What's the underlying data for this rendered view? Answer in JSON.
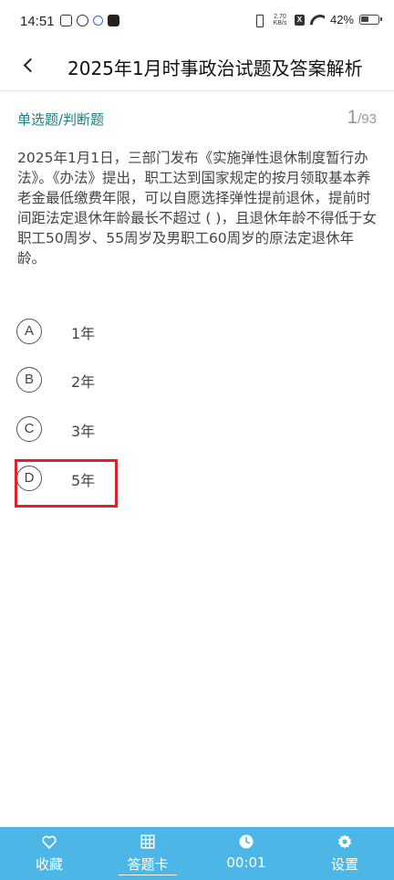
{
  "status_bar": {
    "time": "14:51",
    "net_speed_value": "2.70",
    "net_speed_unit": "KB/s",
    "sim_label": "X",
    "battery": "42%"
  },
  "header": {
    "title": "2025年1月时事政治试题及答案解析"
  },
  "question": {
    "type": "单选题/判断题",
    "current": "1",
    "total": "/93",
    "text": "2025年1月1日，三部门发布《实施弹性退休制度暂行办法》。《办法》提出，职工达到国家规定的按月领取基本养老金最低缴费年限，可以自愿选择弹性提前退休，提前时间距法定退休年龄最长不超过 ( )，且退休年龄不得低于女职工50周岁、55周岁及男职工60周岁的原法定退休年龄。",
    "options": [
      {
        "letter": "A",
        "text": "1年"
      },
      {
        "letter": "B",
        "text": "2年"
      },
      {
        "letter": "C",
        "text": "3年"
      },
      {
        "letter": "D",
        "text": "5年"
      }
    ]
  },
  "bottom_bar": {
    "favorite_label": "收藏",
    "answer_card_label": "答题卡",
    "timer": "00:01",
    "settings_label": "设置"
  },
  "colors": {
    "accent": "#4cb7e6",
    "type_label": "#1a7f86",
    "highlight": "#e0202a"
  }
}
